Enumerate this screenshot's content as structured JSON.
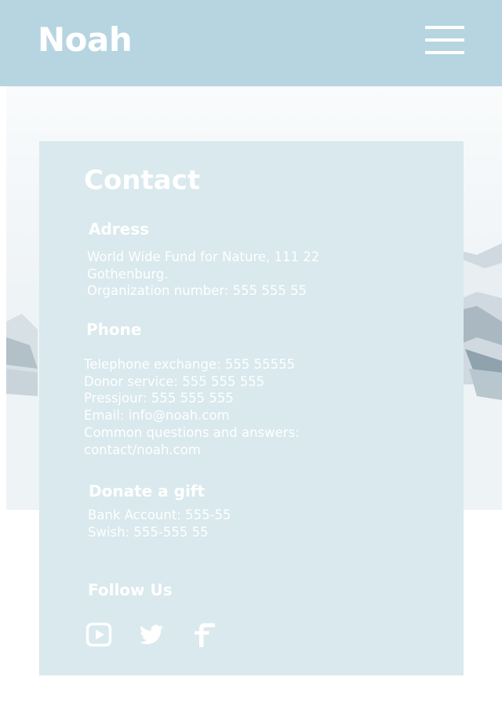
{
  "header": {
    "logo": "Noah",
    "menu_icon": "hamburger-menu-icon",
    "background_color": "#b6d5e1"
  },
  "contact": {
    "title": "Contact",
    "address": {
      "heading": "Adress",
      "lines": [
        "World Wide Fund for Nature, 111 22",
        "Gothenburg.",
        "Organization number: 555 555 55"
      ]
    },
    "phone": {
      "heading": "Phone",
      "lines": [
        "Telephone exchange: 555 55555",
        "Donor service: 555 555 555",
        "Pressjour: 555 555 555",
        "Email: info@noah.com",
        "Common questions and answers:",
        "contact/noah.com"
      ]
    },
    "donate": {
      "heading": "Donate a gift",
      "lines": [
        "Bank Account: 555-55",
        "Swish: 555-555 55"
      ]
    },
    "follow": {
      "heading": "Follow Us",
      "icons": [
        "youtube-icon",
        "twitter-icon",
        "facebook-icon"
      ]
    },
    "card_color": "#d9e9ed"
  }
}
